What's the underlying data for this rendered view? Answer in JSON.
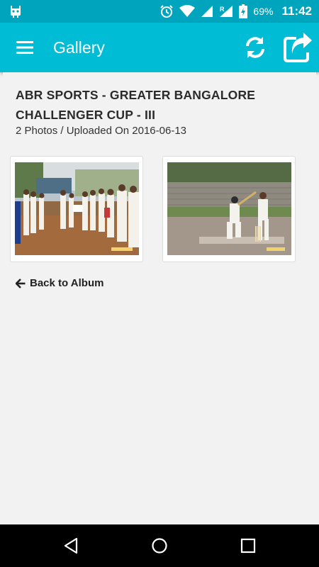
{
  "status_bar": {
    "battery_percent": "69%",
    "time": "11:42",
    "icons": [
      "android-debug-icon",
      "alarm-icon",
      "wifi-icon",
      "signal-icon",
      "roaming-signal-icon",
      "battery-icon"
    ]
  },
  "app_bar": {
    "title": "Gallery",
    "icons": [
      "menu-icon",
      "refresh-icon",
      "share-icon"
    ]
  },
  "album": {
    "title": "ABR SPORTS - GREATER BANGALORE CHALLENGER CUP - III",
    "meta": "2 Photos / Uploaded On 2016-06-13",
    "photos": [
      {
        "subject": "players-lineup-photo"
      },
      {
        "subject": "batsman-batting-photo"
      }
    ]
  },
  "back_link": {
    "label": "Back to Album",
    "icon": "arrow-left-icon"
  },
  "nav_bar": {
    "icons": [
      "back-triangle-icon",
      "home-circle-icon",
      "recents-square-icon"
    ]
  },
  "colors": {
    "status_bar": "#00a5bd",
    "app_bar": "#00bcd4",
    "background": "#f2f2f2",
    "nav_bar": "#000000"
  }
}
